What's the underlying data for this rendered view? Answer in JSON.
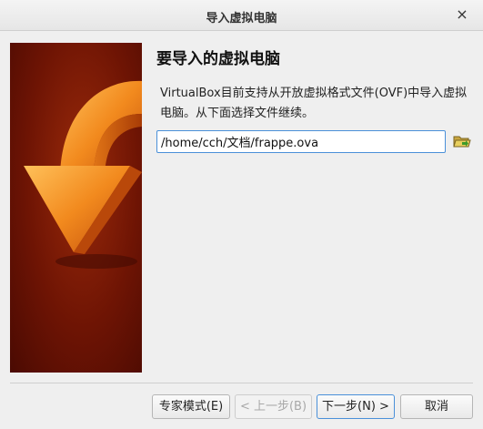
{
  "window": {
    "title": "导入虚拟电脑",
    "close_glyph": "×"
  },
  "page": {
    "heading": "要导入的虚拟电脑",
    "description": "VirtualBox目前支持从开放虚拟格式文件(OVF)中导入虚拟电脑。从下面选择文件继续。",
    "file_path": "/home/cch/文档/frappe.ova"
  },
  "buttons": {
    "expert_mode": "专家模式(E)",
    "back": "< 上一步(B)",
    "next": "下一步(N) >",
    "cancel": "取消"
  },
  "colors": {
    "banner_dark": "#4a0a02",
    "banner_mid": "#9a2a0a",
    "arrow_orange": "#f08a1c",
    "focus_blue": "#4a90d9"
  }
}
